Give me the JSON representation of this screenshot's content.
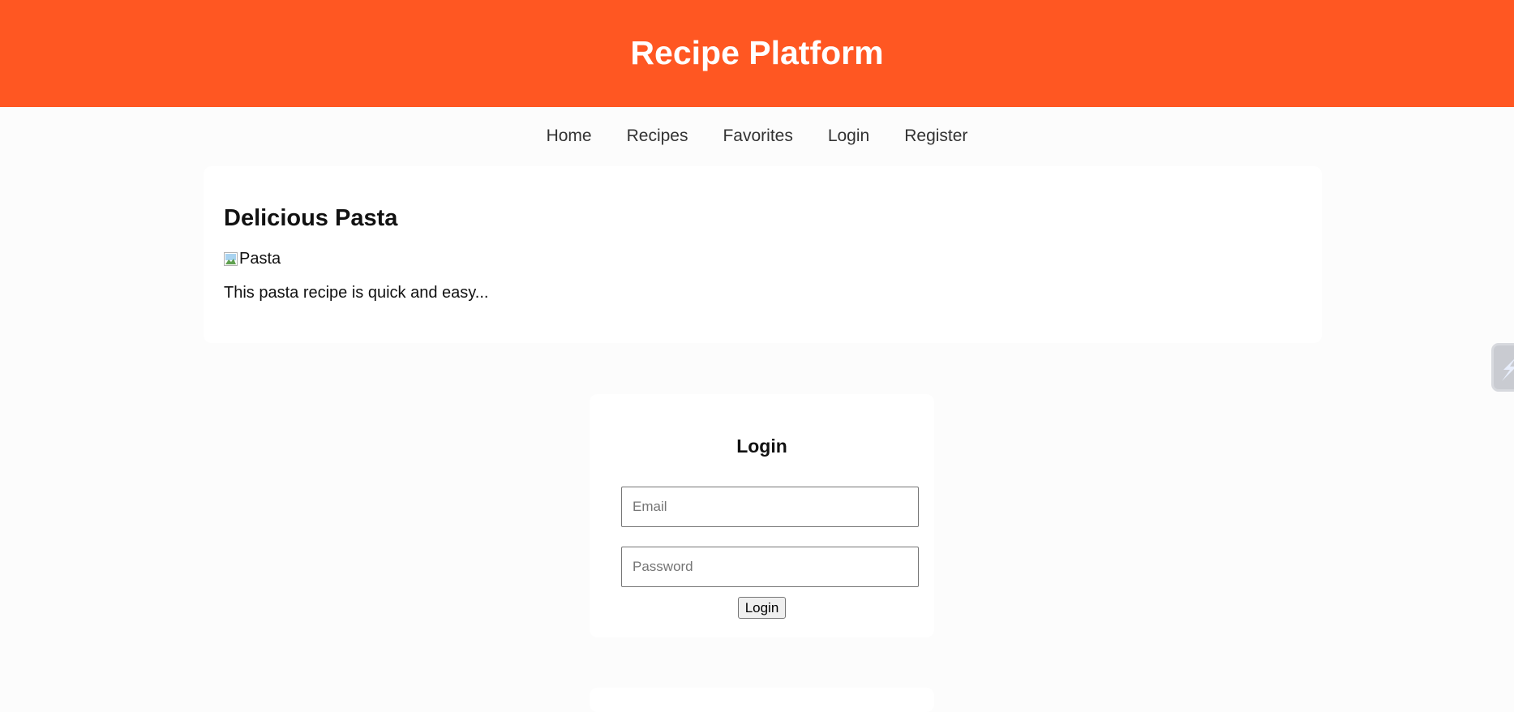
{
  "header": {
    "title": "Recipe Platform",
    "bg_color": "#ff5722"
  },
  "nav": {
    "items": [
      {
        "label": "Home"
      },
      {
        "label": "Recipes"
      },
      {
        "label": "Favorites"
      },
      {
        "label": "Login"
      },
      {
        "label": "Register"
      }
    ]
  },
  "recipe": {
    "title": "Delicious Pasta",
    "image_alt": "Pasta",
    "image_icon": "broken-image-icon",
    "description": "This pasta recipe is quick and easy..."
  },
  "login": {
    "title": "Login",
    "email_placeholder": "Email",
    "password_placeholder": "Password",
    "submit_label": "Login"
  },
  "side_widget": {
    "icon": "extension-icon"
  }
}
